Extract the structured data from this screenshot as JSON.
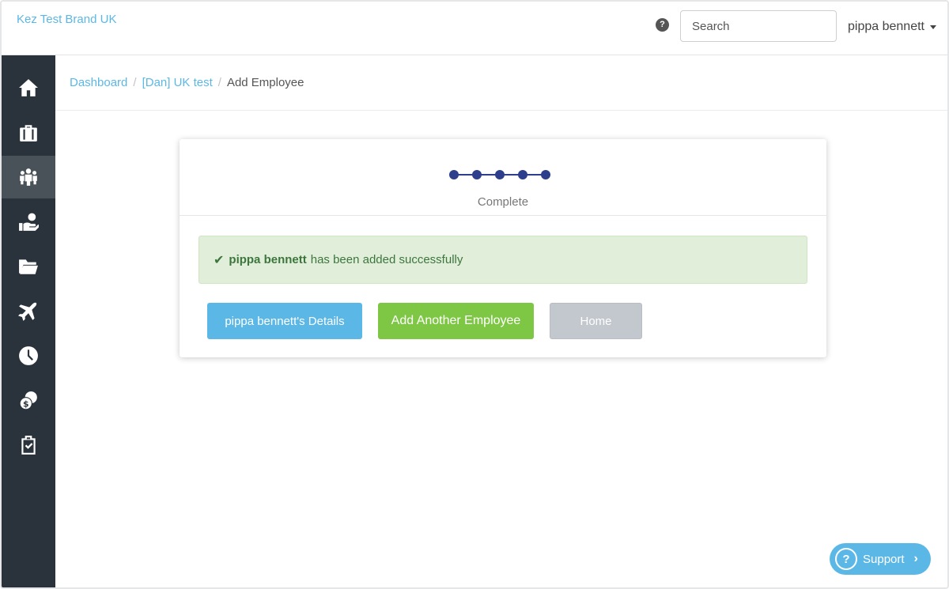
{
  "app": {
    "brand": "Kez Test Brand UK",
    "help_icon": "?"
  },
  "header": {
    "search_placeholder": "Search",
    "user_name": "pippa bennett"
  },
  "sidebar": {
    "items": [
      {
        "icon": "home-icon",
        "active": false
      },
      {
        "icon": "briefcase-icon",
        "active": false
      },
      {
        "icon": "employees-icon",
        "active": true
      },
      {
        "icon": "payroll-hand-icon",
        "active": false
      },
      {
        "icon": "folder-icon",
        "active": false
      },
      {
        "icon": "airplane-icon",
        "active": false
      },
      {
        "icon": "clock-icon",
        "active": false
      },
      {
        "icon": "coins-icon",
        "active": false
      },
      {
        "icon": "clipboard-check-icon",
        "active": false
      }
    ]
  },
  "breadcrumb": {
    "items": [
      "Dashboard",
      "[Dan] UK test"
    ],
    "separator": "/",
    "current": "Add Employee"
  },
  "wizard": {
    "step_count": 5,
    "status_label": "Complete"
  },
  "alert": {
    "check_icon": "✔",
    "employee_name": "pippa bennett",
    "message": "has been added successfully"
  },
  "actions": {
    "details_label": "pippa bennett's Details",
    "add_another_label": "Add Another Employee",
    "home_label": "Home"
  },
  "support": {
    "icon": "?",
    "label": "Support",
    "chevron": "›"
  },
  "colors": {
    "accent_blue": "#5bb8e6",
    "success_green": "#7ec744",
    "sidebar_bg": "#2a333c",
    "stepper": "#2d3e8c"
  }
}
